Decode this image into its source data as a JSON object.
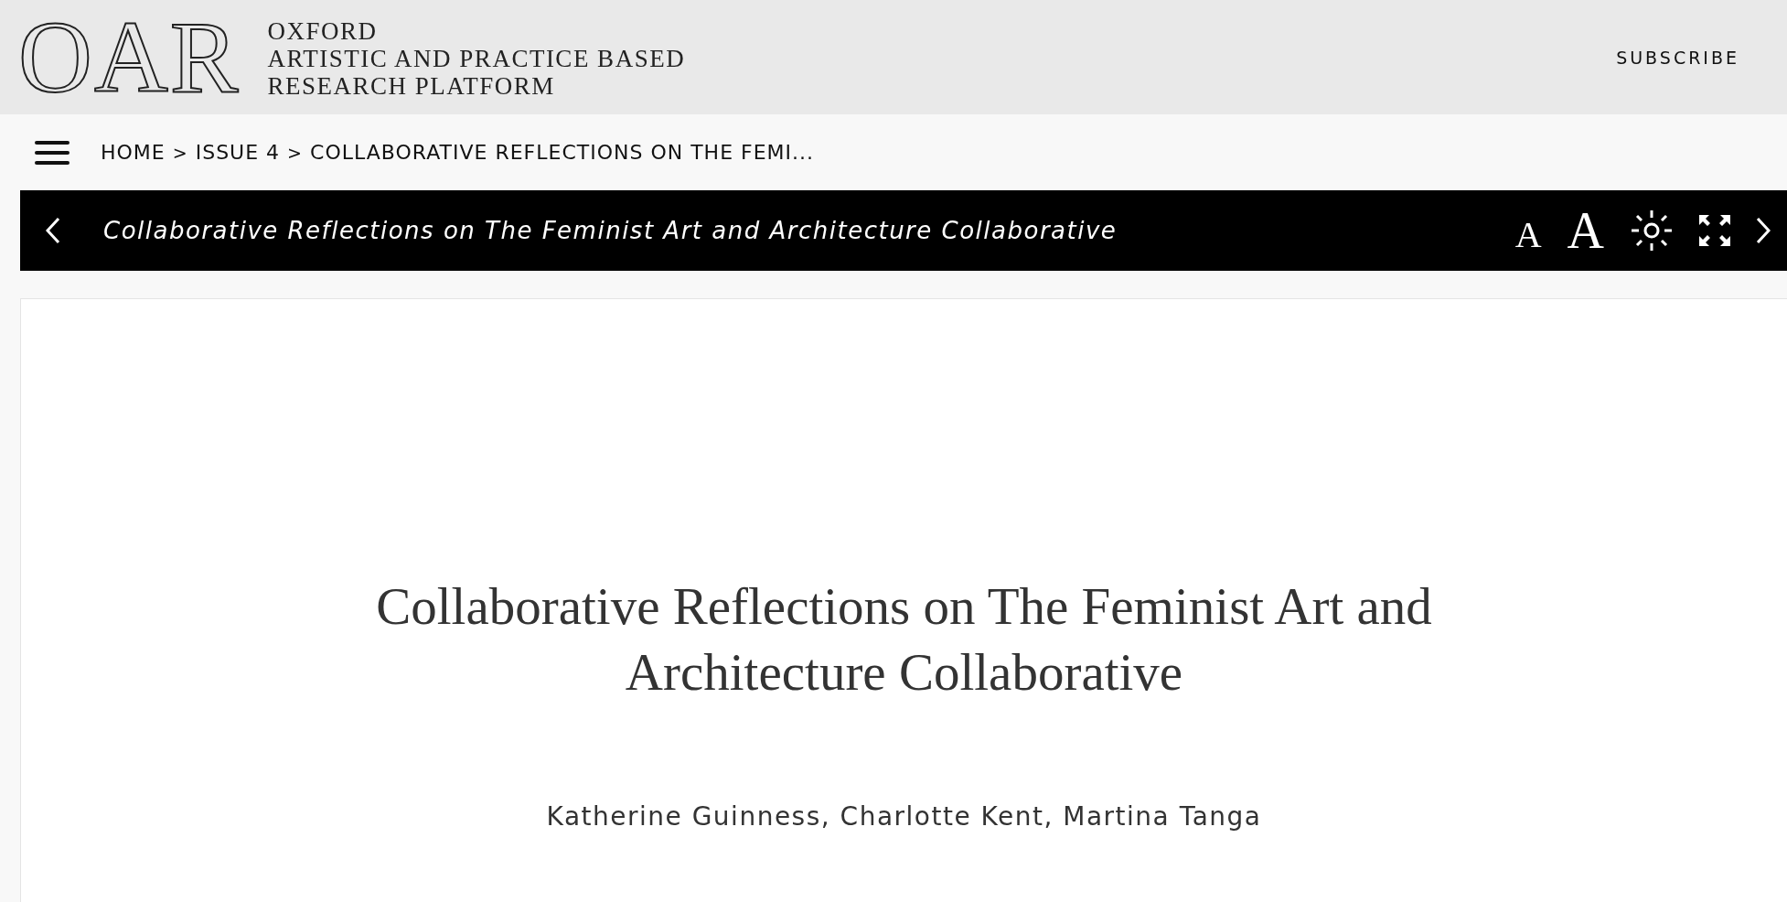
{
  "header": {
    "logo": "OAR",
    "platform_name": [
      "OXFORD",
      "ARTISTIC AND PRACTICE BASED",
      "RESEARCH PLATFORM"
    ],
    "subscribe": "SUBSCRIBE"
  },
  "breadcrumb": [
    {
      "kind": "link",
      "text": "HOME"
    },
    {
      "kind": "separator",
      "text": ">"
    },
    {
      "kind": "link",
      "text": "ISSUE 4"
    },
    {
      "kind": "separator",
      "text": ">"
    },
    {
      "kind": "link",
      "text": "COLLABORATIVE REFLECTIONS ON THE FEMI..."
    }
  ],
  "toolbar": {
    "title": "Collaborative Reflections on The Feminist Art and Architecture Collaborative",
    "tools": [
      {
        "kind": "font-small",
        "text": "A"
      },
      {
        "kind": "font-large",
        "text": "A"
      },
      {
        "kind": "brightness"
      },
      {
        "kind": "fullscreen"
      },
      {
        "kind": "next"
      }
    ]
  },
  "article": {
    "title": "Collaborative Reflections on The Feminist Art and Architecture Collaborative",
    "authors": "Katherine Guinness, Charlotte Kent, Martina Tanga"
  }
}
